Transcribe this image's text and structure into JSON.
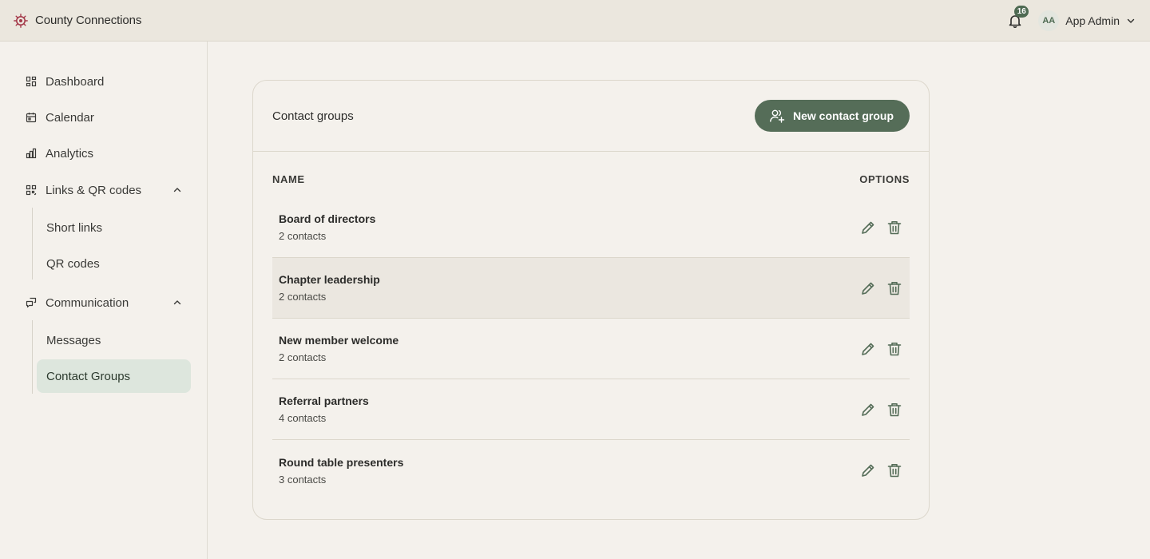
{
  "header": {
    "brand": "County Connections",
    "notifications_count": "16",
    "user_initials": "AA",
    "user_name": "App Admin"
  },
  "sidebar": {
    "items": [
      {
        "label": "Dashboard",
        "icon": "dashboard-icon"
      },
      {
        "label": "Calendar",
        "icon": "calendar-icon"
      },
      {
        "label": "Analytics",
        "icon": "bar-chart-icon"
      },
      {
        "label": "Links & QR codes",
        "icon": "qr-icon",
        "children": [
          {
            "label": "Short links"
          },
          {
            "label": "QR codes"
          }
        ]
      },
      {
        "label": "Communication",
        "icon": "chat-icon",
        "children": [
          {
            "label": "Messages"
          },
          {
            "label": "Contact Groups",
            "active": true
          }
        ]
      }
    ]
  },
  "main": {
    "title": "Contact groups",
    "new_button": "New contact group",
    "columns": {
      "name": "NAME",
      "options": "OPTIONS"
    },
    "groups": [
      {
        "name": "Board of directors",
        "count": "2 contacts"
      },
      {
        "name": "Chapter leadership",
        "count": "2 contacts"
      },
      {
        "name": "New member welcome",
        "count": "2 contacts"
      },
      {
        "name": "Referral partners",
        "count": "4 contacts"
      },
      {
        "name": "Round table presenters",
        "count": "3 contacts"
      }
    ]
  },
  "colors": {
    "accent": "#556d58",
    "active_nav": "#dde6dd",
    "background": "#f4f1ec"
  }
}
